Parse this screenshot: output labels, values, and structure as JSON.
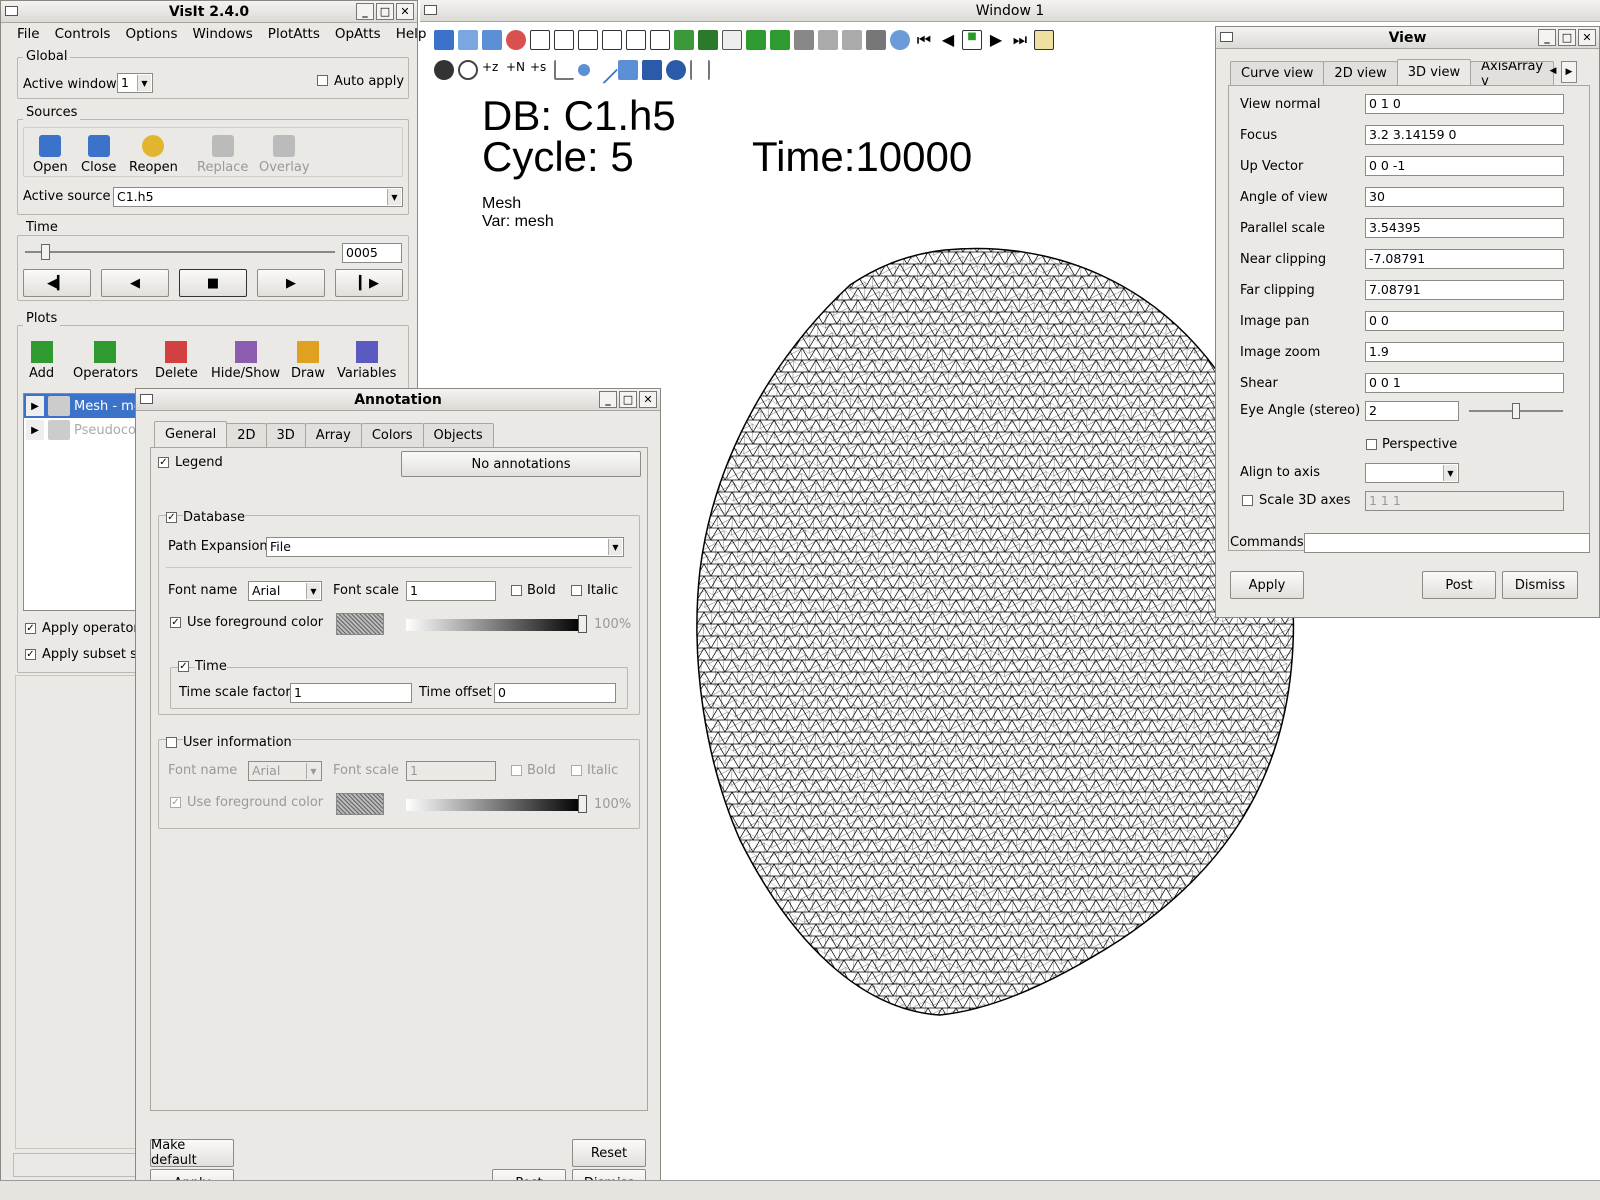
{
  "main_window": {
    "title": "VisIt 2.4.0",
    "menu": [
      "File",
      "Controls",
      "Options",
      "Windows",
      "PlotAtts",
      "OpAtts",
      "Help"
    ],
    "global": {
      "group_label": "Global",
      "active_window_label": "Active window",
      "active_window_value": "1",
      "auto_apply_label": "Auto apply"
    },
    "sources": {
      "group_label": "Sources",
      "buttons": [
        "Open",
        "Close",
        "Reopen",
        "Replace",
        "Overlay"
      ],
      "active_source_label": "Active source",
      "active_source_value": "C1.h5"
    },
    "time": {
      "group_label": "Time",
      "frame_value": "0005"
    },
    "plots": {
      "group_label": "Plots",
      "buttons": [
        "Add",
        "Operators",
        "Delete",
        "Hide/Show",
        "Draw",
        "Variables"
      ],
      "list": [
        {
          "label": "Mesh - me"
        },
        {
          "label": "Pseudoco"
        }
      ],
      "apply_operators_label": "Apply operators",
      "apply_subset_label": "Apply subset se"
    }
  },
  "vis_window": {
    "title": "Window 1",
    "db_label": "DB: C1.h5",
    "cycle_label": "Cycle: 5",
    "time_label": "Time:10000",
    "plot_name": "Mesh",
    "var_label": "Var: mesh"
  },
  "annotation": {
    "title": "Annotation",
    "tabs": [
      "General",
      "2D",
      "3D",
      "Array",
      "Colors",
      "Objects"
    ],
    "legend_label": "Legend",
    "no_annotations_label": "No annotations",
    "database_label": "Database",
    "path_expansion_label": "Path Expansion",
    "path_expansion_value": "File",
    "font_name_label": "Font name",
    "font_name_value": "Arial",
    "font_scale_label": "Font scale",
    "font_scale_value": "1",
    "bold_label": "Bold",
    "italic_label": "Italic",
    "use_fg_label": "Use foreground color",
    "opacity_label": "100%",
    "opacity_value": 1.0,
    "time_label": "Time",
    "time_scale_label": "Time scale factor",
    "time_scale_value": "1",
    "time_offset_label": "Time offset",
    "time_offset_value": "0",
    "user_info_label": "User information",
    "make_default_label": "Make default",
    "reset_label": "Reset",
    "apply_label": "Apply",
    "post_label": "Post",
    "dismiss_label": "Dismiss"
  },
  "view": {
    "title": "View",
    "tabs": [
      "Curve view",
      "2D view",
      "3D view",
      "AxisArray v"
    ],
    "fields": [
      {
        "label": "View normal",
        "value": "0 1 0"
      },
      {
        "label": "Focus",
        "value": "3.2 3.14159 0"
      },
      {
        "label": "Up Vector",
        "value": "0 0 -1"
      },
      {
        "label": "Angle of view",
        "value": "30"
      },
      {
        "label": "Parallel scale",
        "value": "3.54395"
      },
      {
        "label": "Near clipping",
        "value": "-7.08791"
      },
      {
        "label": "Far clipping",
        "value": "7.08791"
      },
      {
        "label": "Image pan",
        "value": "0 0"
      },
      {
        "label": "Image zoom",
        "value": "1.9"
      },
      {
        "label": "Shear",
        "value": "0 0 1"
      }
    ],
    "eye_angle_label": "Eye Angle (stereo)",
    "eye_angle_value": "2",
    "perspective_label": "Perspective",
    "align_label": "Align to axis",
    "scale3d_label": "Scale 3D axes",
    "scale3d_value": "1 1 1",
    "commands_label": "Commands",
    "apply_label": "Apply",
    "post_label": "Post",
    "dismiss_label": "Dismiss"
  }
}
